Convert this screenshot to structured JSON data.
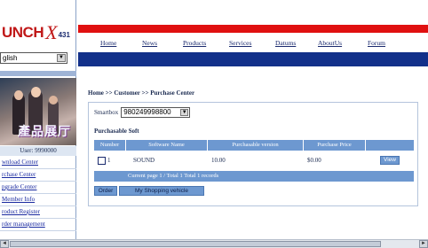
{
  "logo": {
    "brand": "UNCH",
    "x_mark": "X",
    "model": "431"
  },
  "language": {
    "selected": "glish",
    "arrow": "▼"
  },
  "sidebar": {
    "photo_caption": "產品展厅",
    "user_line": "User: 9990000",
    "menu": [
      "wnload Center",
      "rchase Center",
      "pgrade Center",
      "Member Info",
      "roduct Register",
      "rder management"
    ]
  },
  "nav": {
    "items": [
      "Home",
      "News",
      "Products",
      "Services",
      "Datums",
      "AboutUs",
      "Forum"
    ]
  },
  "breadcrumb": "Home >> Customer >> Purchase Center",
  "smartbox": {
    "label": "Smartbox",
    "value": "980249998800",
    "arrow": "▼"
  },
  "purchasable": {
    "title": "Purchasable Soft",
    "headers": [
      "Number",
      "Software Name",
      "Purchasable version",
      "Purchase Price",
      ""
    ],
    "rows": [
      {
        "number": "1",
        "name": "SOUND",
        "version": "10.00",
        "price": "$0.00",
        "action": "View"
      }
    ],
    "page_info": "Current page 1 / Total 1   Total 1 records"
  },
  "buttons": {
    "order": "Order",
    "cart": "My Shopping vehicle"
  },
  "scrollbar": {
    "left_arrow": "◄",
    "right_arrow": "►"
  }
}
